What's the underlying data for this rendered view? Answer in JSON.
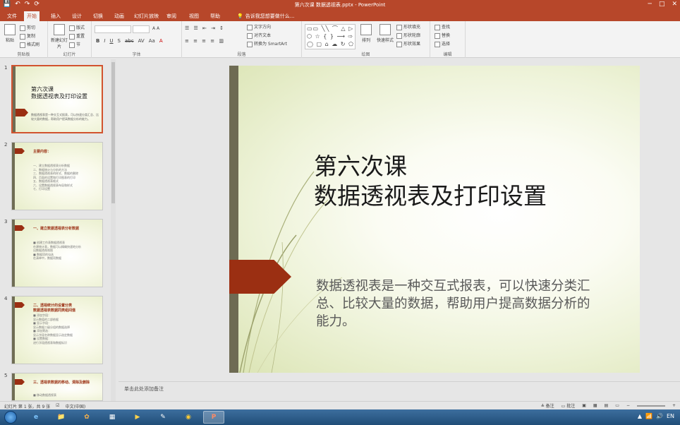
{
  "app": {
    "title": "第六次课 数据透视表.pptx - PowerPoint",
    "qat": [
      "💾",
      "↶",
      "↷",
      "⟳"
    ],
    "window_controls": [
      "─",
      "□",
      "✕"
    ]
  },
  "tabs": [
    "文件",
    "开始",
    "插入",
    "设计",
    "切换",
    "动画",
    "幻灯片放映",
    "审阅",
    "视图",
    "帮助"
  ],
  "active_tab": "开始",
  "tell_me": "告诉我您想要做什么...",
  "ribbon": {
    "clipboard": {
      "paste": "粘贴",
      "cut": "剪切",
      "copy": "复制",
      "format_painter": "格式刷",
      "label": "剪贴板"
    },
    "slides": {
      "new_slide": "新建幻灯片",
      "layout": "版式",
      "reset": "重置",
      "section": "节",
      "label": "幻灯片"
    },
    "font": {
      "bold": "B",
      "italic": "I",
      "underline": "U",
      "shadow": "S",
      "strike": "abc",
      "spacing": "AV",
      "case": "Aa",
      "color": "A",
      "label": "字体"
    },
    "paragraph": {
      "text_direction": "文字方向",
      "align_text": "对齐文本",
      "smartart": "转换为 SmartArt",
      "label": "段落"
    },
    "drawing": {
      "shapes_grid": "▭▭ ╲╲ ⌒ △ ▷ ⬡ ☆ { } ⟶ ⇨ ◯ ▢ ⌂ ☁ ↻ ⬠",
      "arrange": "排列",
      "quick_styles": "快速样式",
      "shape_fill": "形状填充",
      "shape_outline": "形状轮廓",
      "shape_effects": "形状效果",
      "label": "绘图"
    },
    "editing": {
      "find": "查找",
      "replace": "替换",
      "select": "选择",
      "label": "编辑"
    }
  },
  "thumbnails": [
    {
      "num": "1",
      "title": "第六次课\n数据透视表及打印设置",
      "body": "数据透视表是一种交互式报表，可以快速分类汇总、比较大量的数据，帮助用户提高数据分析的能力。"
    },
    {
      "num": "2",
      "heading": "主要内容：",
      "lines": "一、建立数据透视表分析数据\n二、数据统计与分析的方法\n三、数据透视表的样式、数据的删除\n四、页面的设置和打印图表的打印\n五、数据透视表格式\n六、设置数据透视表布局和样式\n七、打印设置"
    },
    {
      "num": "3",
      "heading": "一、建立数据透视表分析数据",
      "lines": "■ 创建工作表数据透视表\n  在建统计表，数据可以精确快速地分析\n  出数据透视视图\n■ 数据项的勾选\n  在清单中，数据项数据"
    },
    {
      "num": "4",
      "heading": "二、透视统计的设置分类\n    数据透视表数据同类组间值",
      "lines": "■ 添加字段：\n  显示数值的二部依据\n■ 显示字段：\n  显示数据二级分组的数据选择\n■ 添加筛选：\n  显示字段名称数据显示选定数据\n■ 设置数据：\n  进行字段透视表和数据标识"
    },
    {
      "num": "5",
      "heading": "三、透视表数据的移动、清除及删除",
      "lines": "■ 移动数据透视表"
    }
  ],
  "slide": {
    "title_line1": "第六次课",
    "title_line2": "数据透视表及打印设置",
    "body": "数据透视表是一种交互式报表，可以快速分类汇总、比较大量的数据，帮助用户提高数据分析的能力。"
  },
  "notes_placeholder": "单击此处添加备注",
  "status": {
    "slide_counter": "幻灯片 第 1 张，共 9 张",
    "language": "中文(中国)",
    "notes_btn": "≜ 备注",
    "comments_btn": "▭ 批注"
  },
  "taskbar": {
    "apps": [
      "e",
      "📁",
      "✿",
      "▦",
      "▶",
      "✎",
      "◉",
      "P"
    ],
    "tray": [
      "▲",
      "📶",
      "🔊",
      "EN"
    ]
  },
  "colors": {
    "accent": "#b7472a",
    "slide_arrow": "#9b2f12",
    "slide_bar": "#6e6b53"
  }
}
